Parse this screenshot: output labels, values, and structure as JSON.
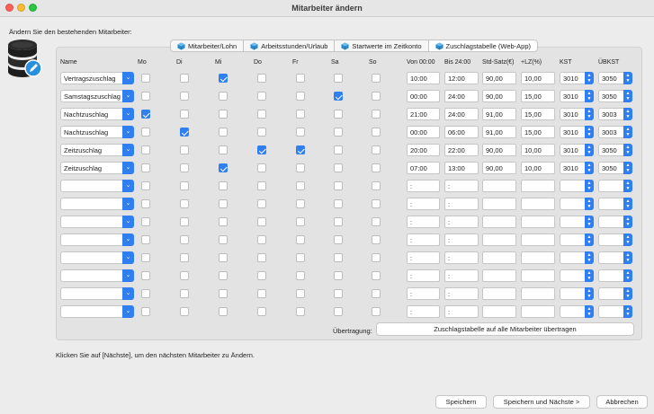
{
  "window": {
    "title": "Mitarbeiter ändern"
  },
  "intro_text": "Ändern Sie den bestehenden Mitarbeiter:",
  "tabs": [
    {
      "label": "Mitarbeiter/Lohn",
      "active": false
    },
    {
      "label": "Arbeitsstunden/Urlaub",
      "active": false
    },
    {
      "label": "Startwerte im Zeitkonto",
      "active": false
    },
    {
      "label": "Zuschlagstabelle (Web-App)",
      "active": true
    }
  ],
  "headers": {
    "name": "Name",
    "mo": "Mo",
    "di": "Di",
    "mi": "Mi",
    "do": "Do",
    "fr": "Fr",
    "sa": "Sa",
    "so": "So",
    "von": "Von 00:00",
    "bis": "Bis 24:00",
    "std_satz": "Std-Satz(€)",
    "lz": "+LZ(%)",
    "kst": "KST",
    "uebkst": "ÜBKST"
  },
  "rows": [
    {
      "name": "Vertragszuschlag",
      "days": [
        false,
        false,
        true,
        false,
        false,
        false,
        false
      ],
      "von": "10:00",
      "bis": "12:00",
      "std_satz": "90,00",
      "lz": "10,00",
      "kst": "3010",
      "uebkst": "3050"
    },
    {
      "name": "Samstagszuschlag",
      "days": [
        false,
        false,
        false,
        false,
        false,
        true,
        false
      ],
      "von": "00:00",
      "bis": "24:00",
      "std_satz": "90,00",
      "lz": "15,00",
      "kst": "3010",
      "uebkst": "3050"
    },
    {
      "name": "Nachtzuschlag",
      "days": [
        true,
        false,
        false,
        false,
        false,
        false,
        false
      ],
      "von": "21:00",
      "bis": "24:00",
      "std_satz": "91,00",
      "lz": "15,00",
      "kst": "3010",
      "uebkst": "3003"
    },
    {
      "name": "Nachtzuschlag",
      "days": [
        false,
        true,
        false,
        false,
        false,
        false,
        false
      ],
      "von": "00:00",
      "bis": "06:00",
      "std_satz": "91,00",
      "lz": "15,00",
      "kst": "3010",
      "uebkst": "3003"
    },
    {
      "name": "Zeitzuschlag",
      "days": [
        false,
        false,
        false,
        true,
        true,
        false,
        false
      ],
      "von": "20:00",
      "bis": "22:00",
      "std_satz": "90,00",
      "lz": "10,00",
      "kst": "3010",
      "uebkst": "3050"
    },
    {
      "name": "Zeitzuschlag",
      "days": [
        false,
        false,
        true,
        false,
        false,
        false,
        false
      ],
      "von": "07:00",
      "bis": "13:00",
      "std_satz": "90,00",
      "lz": "10,00",
      "kst": "3010",
      "uebkst": "3050"
    },
    {
      "name": "",
      "days": [
        false,
        false,
        false,
        false,
        false,
        false,
        false
      ],
      "von": " :",
      "bis": " :",
      "std_satz": "",
      "lz": "",
      "kst": "",
      "uebkst": ""
    },
    {
      "name": "",
      "days": [
        false,
        false,
        false,
        false,
        false,
        false,
        false
      ],
      "von": " :",
      "bis": " :",
      "std_satz": "",
      "lz": "",
      "kst": "",
      "uebkst": ""
    },
    {
      "name": "",
      "days": [
        false,
        false,
        false,
        false,
        false,
        false,
        false
      ],
      "von": " :",
      "bis": " :",
      "std_satz": "",
      "lz": "",
      "kst": "",
      "uebkst": ""
    },
    {
      "name": "",
      "days": [
        false,
        false,
        false,
        false,
        false,
        false,
        false
      ],
      "von": " :",
      "bis": " :",
      "std_satz": "",
      "lz": "",
      "kst": "",
      "uebkst": ""
    },
    {
      "name": "",
      "days": [
        false,
        false,
        false,
        false,
        false,
        false,
        false
      ],
      "von": " :",
      "bis": " :",
      "std_satz": "",
      "lz": "",
      "kst": "",
      "uebkst": ""
    },
    {
      "name": "",
      "days": [
        false,
        false,
        false,
        false,
        false,
        false,
        false
      ],
      "von": " :",
      "bis": " :",
      "std_satz": "",
      "lz": "",
      "kst": "",
      "uebkst": ""
    },
    {
      "name": "",
      "days": [
        false,
        false,
        false,
        false,
        false,
        false,
        false
      ],
      "von": " :",
      "bis": " :",
      "std_satz": "",
      "lz": "",
      "kst": "",
      "uebkst": ""
    },
    {
      "name": "",
      "days": [
        false,
        false,
        false,
        false,
        false,
        false,
        false
      ],
      "von": " :",
      "bis": " :",
      "std_satz": "",
      "lz": "",
      "kst": "",
      "uebkst": ""
    }
  ],
  "uebertragung_label": "Übertragung:",
  "transfer_button": "Zuschlagstabelle auf alle Mitarbeiter übertragen",
  "footer_note": "Klicken Sie auf [Nächste], um den nächsten Mitarbeiter zu Ändern.",
  "buttons": {
    "save": "Speichern",
    "save_next": "Speichern und Nächste >",
    "cancel": "Abbrechen"
  },
  "colors": {
    "accent": "#2f7ff0",
    "tab_icon": "#2a8ac8"
  },
  "icons": {
    "app": "database-edit-icon",
    "tab": "cube-icon",
    "dropdown": "chevron-down-icon",
    "stepper": "stepper-icon"
  }
}
